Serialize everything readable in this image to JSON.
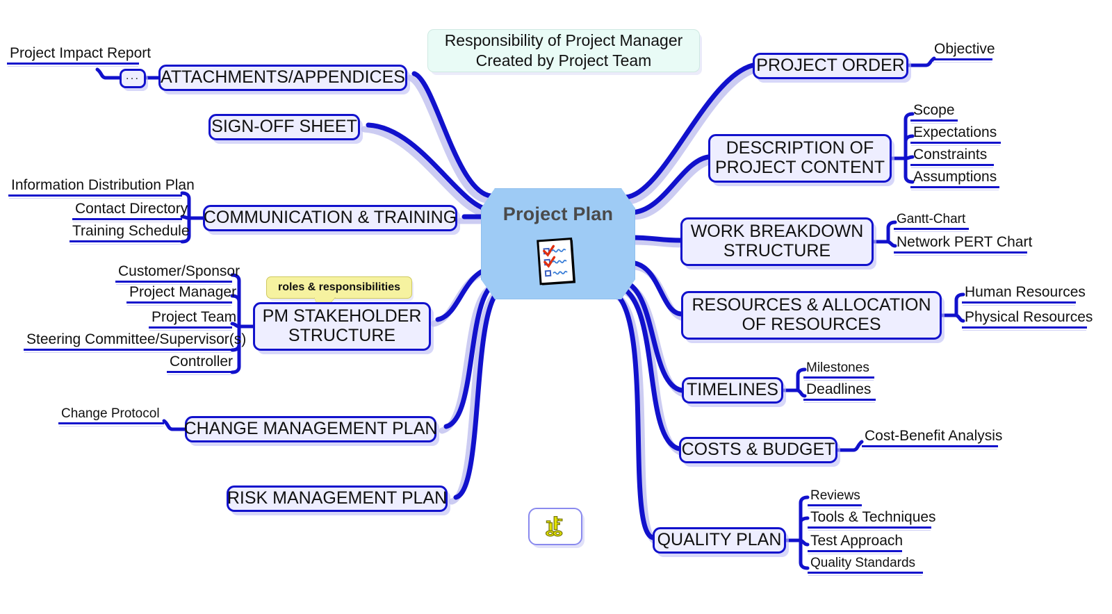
{
  "title": "Project Plan",
  "header_note": {
    "line1": "Responsibility of Project Manager",
    "line2": "Created by Project Team"
  },
  "roles_note": "roles & responsibilities",
  "icons": {
    "center": "checklist-icon",
    "floating": "keys-icon"
  },
  "colors": {
    "branch_line": "#1111cc",
    "branch_shadow": "#c8c8f5",
    "topic_fill": "#eeeeff",
    "topic_border": "#1111cc",
    "center_fill": "#9ecbf5",
    "center_text": "#4a4a4a",
    "header_fill": "#e9fbf6",
    "note_fill": "#f6f2a0",
    "key_icon": "#d8d800"
  },
  "right_branches": [
    {
      "label": "PROJECT ORDER",
      "subs": [
        "Objective"
      ]
    },
    {
      "label": "DESCRIPTION OF\nPROJECT CONTENT",
      "line1": "DESCRIPTION OF",
      "line2": "PROJECT CONTENT",
      "subs": [
        "Scope",
        "Expectations",
        "Constraints",
        "Assumptions"
      ]
    },
    {
      "label": "WORK BREAKDOWN\nSTRUCTURE",
      "line1": "WORK BREAKDOWN",
      "line2": "STRUCTURE",
      "subs": [
        "Gantt-Chart",
        "Network PERT Chart"
      ]
    },
    {
      "label": "RESOURCES & ALLOCATION\nOF RESOURCES",
      "line1": "RESOURCES & ALLOCATION",
      "line2": "OF RESOURCES",
      "subs": [
        "Human Resources",
        "Physical Resources"
      ]
    },
    {
      "label": "TIMELINES",
      "subs": [
        "Milestones",
        "Deadlines"
      ]
    },
    {
      "label": "COSTS & BUDGET",
      "subs": [
        "Cost-Benefit Analysis"
      ]
    },
    {
      "label": "QUALITY PLAN",
      "subs": [
        "Reviews",
        "Tools & Techniques",
        "Test Approach",
        "Quality Standards"
      ]
    }
  ],
  "left_branches": [
    {
      "label": "ATTACHMENTS/APPENDICES",
      "dots": "...",
      "subs": [
        "Project Impact Report"
      ]
    },
    {
      "label": "SIGN-OFF SHEET",
      "subs": []
    },
    {
      "label": "COMMUNICATION & TRAINING",
      "subs": [
        "Information Distribution Plan",
        "Contact Directory",
        "Training Schedule"
      ]
    },
    {
      "label": "PM STAKEHOLDER\nSTRUCTURE",
      "line1": "PM STAKEHOLDER",
      "line2": "STRUCTURE",
      "subs": [
        "Customer/Sponsor",
        "Project Manager",
        "Project Team",
        "Steering Committee/Supervisor(s)",
        "Controller"
      ]
    },
    {
      "label": "CHANGE MANAGEMENT PLAN",
      "subs": [
        "Change Protocol"
      ]
    },
    {
      "label": "RISK MANAGEMENT PLAN",
      "subs": []
    }
  ]
}
